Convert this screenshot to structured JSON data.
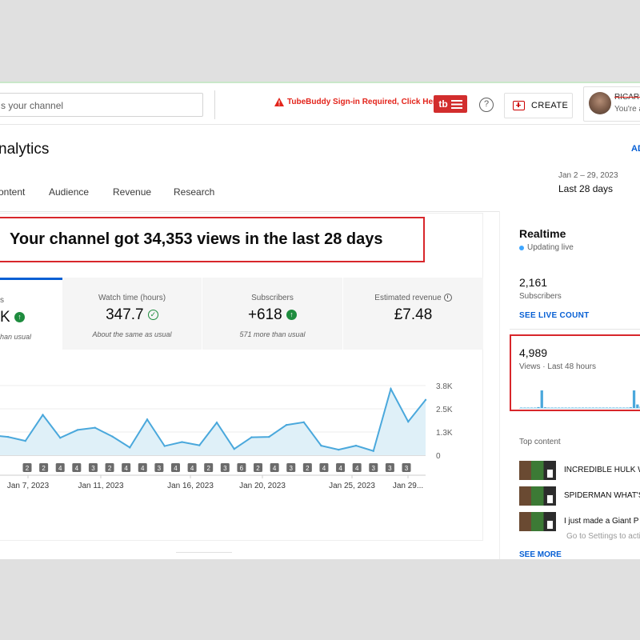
{
  "header": {
    "search_placeholder": "s your channel",
    "tubebuddy_warning": "TubeBuddy Sign-in Required, Click Here",
    "tubebuddy_logo": "tb",
    "help_label": "?",
    "create_label": "CREATE",
    "account_name": "RICARD",
    "account_sub": "You're a"
  },
  "page": {
    "title": "nalytics",
    "advanced_link": "AD",
    "tabs": [
      "ontent",
      "Audience",
      "Revenue",
      "Research"
    ],
    "date_range": "Jan 2 – 29, 2023",
    "period": "Last 28 days"
  },
  "headline": "Your channel got 34,353 views in the last 28 days",
  "metrics": [
    {
      "title": "s",
      "value": "K",
      "sub": "han usual",
      "trend_icon": "arrow-up-icon"
    },
    {
      "title": "Watch time (hours)",
      "value": "347.7",
      "sub": "About the same as usual",
      "trend_icon": "check-icon"
    },
    {
      "title": "Subscribers",
      "value": "+618",
      "sub": "571 more than usual",
      "trend_icon": "arrow-up-icon"
    },
    {
      "title": "Estimated revenue",
      "value": "£7.48",
      "sub": "",
      "trend_icon": "clock-icon"
    }
  ],
  "chart_data": {
    "type": "area",
    "series": [
      {
        "values": [
          1000,
          780,
          2200,
          950,
          1380,
          1500,
          1020,
          420,
          1950,
          500,
          720,
          540,
          1780,
          340,
          980,
          1000,
          1650,
          1800,
          520,
          300,
          520,
          230,
          3620,
          1830,
          3020
        ]
      }
    ],
    "x_tick_labels": [
      "Jan 7, 2023",
      "Jan 11, 2023",
      "Jan 16, 2023",
      "Jan 20, 2023",
      "Jan 25, 2023",
      "Jan 29..."
    ],
    "y_tick_labels": [
      "3.8K",
      "2.5K",
      "1.3K",
      "0"
    ],
    "ylim": [
      0,
      3800
    ],
    "upload_markers": [
      "2",
      "2",
      "4",
      "4",
      "3",
      "2",
      "4",
      "4",
      "3",
      "4",
      "4",
      "2",
      "3",
      "6",
      "2",
      "4",
      "3",
      "2",
      "4",
      "4",
      "4",
      "3",
      "3",
      "3"
    ],
    "line_color": "#4aa8dc",
    "fill_color": "#dff0f8"
  },
  "realtime": {
    "title": "Realtime",
    "status": "Updating live",
    "subscribers_value": "2,161",
    "subscribers_label": "Subscribers",
    "see_live_count": "SEE LIVE COUNT",
    "views_value": "4,989",
    "views_label": "Views · Last 48 hours",
    "bars": [
      0,
      0,
      0,
      0,
      0,
      0.05,
      1,
      0.04,
      0,
      0,
      0,
      0,
      0,
      0,
      0,
      0,
      0,
      0,
      0,
      0,
      0,
      0,
      0,
      0,
      0,
      0,
      0,
      0,
      0,
      0,
      0,
      0,
      0.04,
      1,
      0.2,
      0.08,
      0.05
    ],
    "top_content_title": "Top content",
    "top_content": [
      "INCREDIBLE HULK W",
      "SPIDERMAN WHAT'S",
      "I just made a Giant P"
    ],
    "see_more": "SEE MORE",
    "watermark": "Go to Settings to activ"
  },
  "colors": {
    "accent_blue": "#065fd4",
    "highlight_red": "#d8262b",
    "trend_green": "#1e8c3e"
  }
}
